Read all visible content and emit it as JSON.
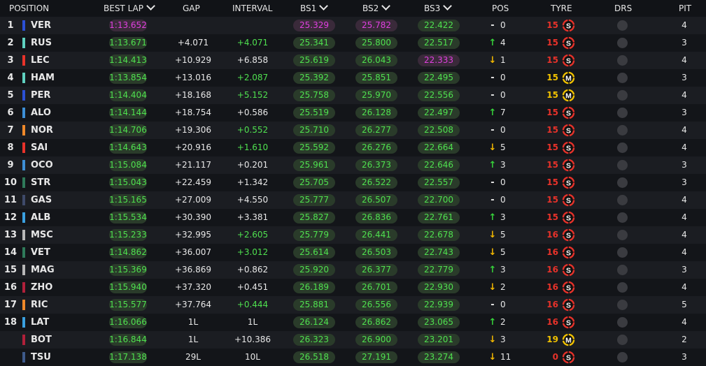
{
  "header": {
    "position": "POSITION",
    "best_lap": "BEST LAP",
    "gap": "GAP",
    "interval": "INTERVAL",
    "bs1": "BS1",
    "bs2": "BS2",
    "bs3": "BS3",
    "pos": "POS",
    "tyre": "TYRE",
    "drs": "DRS",
    "pit": "PIT"
  },
  "colors": {
    "purple": "#e040e0",
    "green": "#4fe04f",
    "soft": "#e8322a",
    "medium": "#f2c200"
  },
  "rows": [
    {
      "pos": "1",
      "driver": "VER",
      "team_color": "#2b50d6",
      "best": "1:13.652",
      "best_s": "purple",
      "gap": "",
      "interval": "",
      "int_s": "",
      "bs1": "25.329",
      "bs1_s": "purple",
      "bs2": "25.782",
      "bs2_s": "purple",
      "bs3": "22.422",
      "bs3_s": "green",
      "dir": "same",
      "arrow": "-",
      "change": "0",
      "tyre_age": "15",
      "compound": "S",
      "drs": "",
      "pit": "4"
    },
    {
      "pos": "2",
      "driver": "RUS",
      "team_color": "#5fd1c0",
      "best": "1:13.671",
      "best_s": "green",
      "gap": "+4.071",
      "interval": "+4.071",
      "int_s": "g",
      "bs1": "25.341",
      "bs1_s": "green",
      "bs2": "25.800",
      "bs2_s": "green",
      "bs3": "22.517",
      "bs3_s": "green",
      "dir": "up",
      "arrow": "↑",
      "change": "4",
      "tyre_age": "15",
      "compound": "S",
      "drs": "",
      "pit": "3"
    },
    {
      "pos": "3",
      "driver": "LEC",
      "team_color": "#e8322a",
      "best": "1:14.413",
      "best_s": "green",
      "gap": "+10.929",
      "interval": "+6.858",
      "int_s": "",
      "bs1": "25.619",
      "bs1_s": "green",
      "bs2": "26.043",
      "bs2_s": "green",
      "bs3": "22.333",
      "bs3_s": "purple",
      "dir": "down",
      "arrow": "↓",
      "change": "1",
      "tyre_age": "15",
      "compound": "S",
      "drs": "",
      "pit": "4"
    },
    {
      "pos": "4",
      "driver": "HAM",
      "team_color": "#5fd1c0",
      "best": "1:13.854",
      "best_s": "green",
      "gap": "+13.016",
      "interval": "+2.087",
      "int_s": "g",
      "bs1": "25.392",
      "bs1_s": "green",
      "bs2": "25.851",
      "bs2_s": "green",
      "bs3": "22.495",
      "bs3_s": "green",
      "dir": "same",
      "arrow": "-",
      "change": "0",
      "tyre_age": "15",
      "compound": "M",
      "drs": "",
      "pit": "3"
    },
    {
      "pos": "5",
      "driver": "PER",
      "team_color": "#2b50d6",
      "best": "1:14.404",
      "best_s": "green",
      "gap": "+18.168",
      "interval": "+5.152",
      "int_s": "g",
      "bs1": "25.758",
      "bs1_s": "green",
      "bs2": "25.970",
      "bs2_s": "green",
      "bs3": "22.556",
      "bs3_s": "green",
      "dir": "same",
      "arrow": "-",
      "change": "0",
      "tyre_age": "15",
      "compound": "M",
      "drs": "",
      "pit": "4"
    },
    {
      "pos": "6",
      "driver": "ALO",
      "team_color": "#3d8fd6",
      "best": "1:14.144",
      "best_s": "green",
      "gap": "+18.754",
      "interval": "+0.586",
      "int_s": "",
      "bs1": "25.519",
      "bs1_s": "green",
      "bs2": "26.128",
      "bs2_s": "green",
      "bs3": "22.497",
      "bs3_s": "green",
      "dir": "up",
      "arrow": "↑",
      "change": "7",
      "tyre_age": "15",
      "compound": "S",
      "drs": "",
      "pit": "3"
    },
    {
      "pos": "7",
      "driver": "NOR",
      "team_color": "#f0892a",
      "best": "1:14.706",
      "best_s": "green",
      "gap": "+19.306",
      "interval": "+0.552",
      "int_s": "g",
      "bs1": "25.710",
      "bs1_s": "green",
      "bs2": "26.277",
      "bs2_s": "green",
      "bs3": "22.508",
      "bs3_s": "green",
      "dir": "same",
      "arrow": "-",
      "change": "0",
      "tyre_age": "15",
      "compound": "S",
      "drs": "",
      "pit": "4"
    },
    {
      "pos": "8",
      "driver": "SAI",
      "team_color": "#e8322a",
      "best": "1:14.643",
      "best_s": "green",
      "gap": "+20.916",
      "interval": "+1.610",
      "int_s": "g",
      "bs1": "25.592",
      "bs1_s": "green",
      "bs2": "26.276",
      "bs2_s": "green",
      "bs3": "22.664",
      "bs3_s": "green",
      "dir": "down",
      "arrow": "↓",
      "change": "5",
      "tyre_age": "15",
      "compound": "S",
      "drs": "",
      "pit": "4"
    },
    {
      "pos": "9",
      "driver": "OCO",
      "team_color": "#3d8fd6",
      "best": "1:15.084",
      "best_s": "green",
      "gap": "+21.117",
      "interval": "+0.201",
      "int_s": "",
      "bs1": "25.961",
      "bs1_s": "green",
      "bs2": "26.373",
      "bs2_s": "green",
      "bs3": "22.646",
      "bs3_s": "green",
      "dir": "up",
      "arrow": "↑",
      "change": "3",
      "tyre_age": "15",
      "compound": "S",
      "drs": "",
      "pit": "3"
    },
    {
      "pos": "10",
      "driver": "STR",
      "team_color": "#2f7a5a",
      "best": "1:15.043",
      "best_s": "green",
      "gap": "+22.459",
      "interval": "+1.342",
      "int_s": "",
      "bs1": "25.705",
      "bs1_s": "green",
      "bs2": "26.522",
      "bs2_s": "green",
      "bs3": "22.557",
      "bs3_s": "green",
      "dir": "same",
      "arrow": "-",
      "change": "0",
      "tyre_age": "15",
      "compound": "S",
      "drs": "",
      "pit": "3"
    },
    {
      "pos": "11",
      "driver": "GAS",
      "team_color": "#3e4a6a",
      "best": "1:15.165",
      "best_s": "green",
      "gap": "+27.009",
      "interval": "+4.550",
      "int_s": "",
      "bs1": "25.777",
      "bs1_s": "green",
      "bs2": "26.507",
      "bs2_s": "green",
      "bs3": "22.700",
      "bs3_s": "green",
      "dir": "same",
      "arrow": "-",
      "change": "0",
      "tyre_age": "15",
      "compound": "S",
      "drs": "",
      "pit": "4"
    },
    {
      "pos": "12",
      "driver": "ALB",
      "team_color": "#3aa0e0",
      "best": "1:15.534",
      "best_s": "green",
      "gap": "+30.390",
      "interval": "+3.381",
      "int_s": "",
      "bs1": "25.827",
      "bs1_s": "green",
      "bs2": "26.836",
      "bs2_s": "green",
      "bs3": "22.761",
      "bs3_s": "green",
      "dir": "up",
      "arrow": "↑",
      "change": "3",
      "tyre_age": "15",
      "compound": "S",
      "drs": "",
      "pit": "4"
    },
    {
      "pos": "13",
      "driver": "MSC",
      "team_color": "#b8b8b8",
      "best": "1:15.233",
      "best_s": "green",
      "gap": "+32.995",
      "interval": "+2.605",
      "int_s": "g",
      "bs1": "25.779",
      "bs1_s": "green",
      "bs2": "26.441",
      "bs2_s": "green",
      "bs3": "22.678",
      "bs3_s": "green",
      "dir": "down",
      "arrow": "↓",
      "change": "5",
      "tyre_age": "16",
      "compound": "S",
      "drs": "",
      "pit": "4"
    },
    {
      "pos": "14",
      "driver": "VET",
      "team_color": "#2f7a5a",
      "best": "1:14.862",
      "best_s": "green",
      "gap": "+36.007",
      "interval": "+3.012",
      "int_s": "g",
      "bs1": "25.614",
      "bs1_s": "green",
      "bs2": "26.503",
      "bs2_s": "green",
      "bs3": "22.743",
      "bs3_s": "green",
      "dir": "down",
      "arrow": "↓",
      "change": "5",
      "tyre_age": "16",
      "compound": "S",
      "drs": "",
      "pit": "4"
    },
    {
      "pos": "15",
      "driver": "MAG",
      "team_color": "#b8b8b8",
      "best": "1:15.369",
      "best_s": "green",
      "gap": "+36.869",
      "interval": "+0.862",
      "int_s": "",
      "bs1": "25.920",
      "bs1_s": "green",
      "bs2": "26.377",
      "bs2_s": "green",
      "bs3": "22.779",
      "bs3_s": "green",
      "dir": "up",
      "arrow": "↑",
      "change": "3",
      "tyre_age": "16",
      "compound": "S",
      "drs": "",
      "pit": "3"
    },
    {
      "pos": "16",
      "driver": "ZHO",
      "team_color": "#b0203a",
      "best": "1:15.940",
      "best_s": "green",
      "gap": "+37.320",
      "interval": "+0.451",
      "int_s": "",
      "bs1": "26.189",
      "bs1_s": "green",
      "bs2": "26.701",
      "bs2_s": "green",
      "bs3": "22.930",
      "bs3_s": "green",
      "dir": "down",
      "arrow": "↓",
      "change": "2",
      "tyre_age": "16",
      "compound": "S",
      "drs": "",
      "pit": "4"
    },
    {
      "pos": "17",
      "driver": "RIC",
      "team_color": "#f0892a",
      "best": "1:15.577",
      "best_s": "green",
      "gap": "+37.764",
      "interval": "+0.444",
      "int_s": "g",
      "bs1": "25.881",
      "bs1_s": "green",
      "bs2": "26.556",
      "bs2_s": "green",
      "bs3": "22.939",
      "bs3_s": "green",
      "dir": "same",
      "arrow": "-",
      "change": "0",
      "tyre_age": "16",
      "compound": "S",
      "drs": "",
      "pit": "5"
    },
    {
      "pos": "18",
      "driver": "LAT",
      "team_color": "#3aa0e0",
      "best": "1:16.066",
      "best_s": "green",
      "gap": "1L",
      "interval": "1L",
      "int_s": "",
      "bs1": "26.124",
      "bs1_s": "green",
      "bs2": "26.862",
      "bs2_s": "green",
      "bs3": "23.065",
      "bs3_s": "green",
      "dir": "up",
      "arrow": "↑",
      "change": "2",
      "tyre_age": "16",
      "compound": "S",
      "drs": "",
      "pit": "4"
    },
    {
      "pos": "",
      "driver": "BOT",
      "team_color": "#b0203a",
      "best": "1:16.844",
      "best_s": "green",
      "gap": "1L",
      "interval": "+10.386",
      "int_s": "",
      "bs1": "26.323",
      "bs1_s": "green",
      "bs2": "26.900",
      "bs2_s": "green",
      "bs3": "23.201",
      "bs3_s": "green",
      "dir": "down",
      "arrow": "↓",
      "change": "3",
      "tyre_age": "19",
      "compound": "M",
      "drs": "",
      "pit": "2"
    },
    {
      "pos": "",
      "driver": "TSU",
      "team_color": "#3e5a8a",
      "best": "1:17.138",
      "best_s": "green",
      "gap": "29L",
      "interval": "10L",
      "int_s": "",
      "bs1": "26.518",
      "bs1_s": "green",
      "bs2": "27.191",
      "bs2_s": "green",
      "bs3": "23.274",
      "bs3_s": "green",
      "dir": "down",
      "arrow": "↓",
      "change": "11",
      "tyre_age": "0",
      "compound": "S",
      "drs": "",
      "pit": "3"
    }
  ]
}
